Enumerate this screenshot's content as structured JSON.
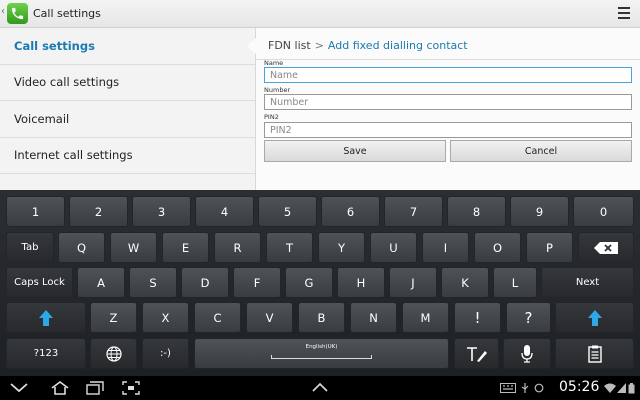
{
  "actionbar": {
    "title": "Call settings"
  },
  "leftpane": {
    "items": [
      {
        "label": "Call settings"
      },
      {
        "label": "Video call settings"
      },
      {
        "label": "Voicemail"
      },
      {
        "label": "Internet call settings"
      }
    ]
  },
  "form": {
    "breadcrumb_parent": "FDN list",
    "breadcrumb_sep": ">",
    "breadcrumb_current": "Add fixed dialling contact",
    "name_label": "Name",
    "name_placeholder": "Name",
    "number_label": "Number",
    "number_placeholder": "Number",
    "pin_label": "PIN2",
    "pin_placeholder": "PIN2",
    "save_label": "Save",
    "cancel_label": "Cancel"
  },
  "keyboard": {
    "row1": [
      "1",
      "2",
      "3",
      "4",
      "5",
      "6",
      "7",
      "8",
      "9",
      "0"
    ],
    "row2": [
      "Q",
      "W",
      "E",
      "R",
      "T",
      "Y",
      "U",
      "I",
      "O",
      "P"
    ],
    "row3": [
      "A",
      "S",
      "D",
      "F",
      "G",
      "H",
      "J",
      "K",
      "L"
    ],
    "row4": [
      "Z",
      "X",
      "C",
      "V",
      "B",
      "N",
      "M",
      "!",
      "?"
    ],
    "tab": "Tab",
    "caps": "Caps Lock",
    "next": "Next",
    "sym": "?123",
    "smiley": ":-)",
    "language": "English(UK)"
  },
  "statusbar": {
    "time": "05:26"
  }
}
